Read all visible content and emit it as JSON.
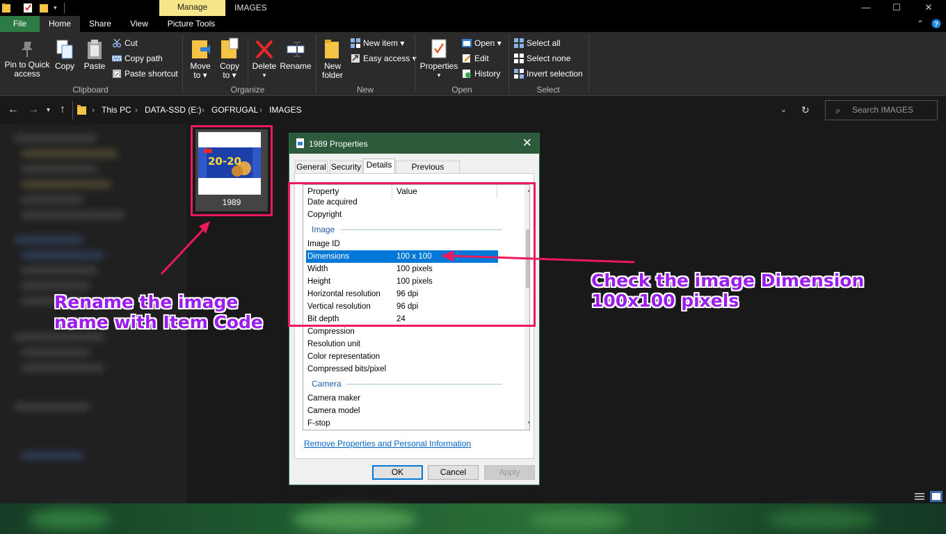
{
  "window": {
    "title": "IMAGES",
    "context_tab": "Manage",
    "controls": {
      "minimize": "—",
      "maximize": "☐",
      "close": "✕"
    }
  },
  "ribbon_tabs": [
    "File",
    "Home",
    "Share",
    "View",
    "Picture Tools"
  ],
  "ribbon": {
    "clipboard": {
      "group_label": "Clipboard",
      "pin_label": "Pin to Quick access",
      "pin_line1": "Pin to Quick",
      "pin_line2": "access",
      "copy_label": "Copy",
      "paste_label": "Paste",
      "cut_label": "Cut",
      "copy_path_label": "Copy path",
      "paste_shortcut_label": "Paste shortcut"
    },
    "organize": {
      "group_label": "Organize",
      "move_to_line1": "Move",
      "move_to_line2": "to ▾",
      "copy_to_line1": "Copy",
      "copy_to_line2": "to ▾",
      "delete_label": "Delete",
      "rename_label": "Rename"
    },
    "new": {
      "group_label": "New",
      "new_folder_line1": "New",
      "new_folder_line2": "folder",
      "new_item_label": "New item ▾",
      "easy_access_label": "Easy access ▾"
    },
    "open": {
      "group_label": "Open",
      "properties_label": "Properties",
      "open_label": "Open ▾",
      "edit_label": "Edit",
      "history_label": "History"
    },
    "select": {
      "group_label": "Select",
      "select_all_label": "Select all",
      "select_none_label": "Select none",
      "invert_selection_label": "Invert selection"
    }
  },
  "address": {
    "breadcrumbs": [
      "This PC",
      "DATA-SSD (E:)",
      "GOFRUGAL",
      "IMAGES"
    ],
    "search_placeholder": "Search IMAGES"
  },
  "file": {
    "name": "1989",
    "thumbnail_text": "20-20"
  },
  "dialog": {
    "title": "1989 Properties",
    "tabs": [
      "General",
      "Security",
      "Details",
      "Previous Versions"
    ],
    "active_tab": "Details",
    "columns": {
      "property": "Property",
      "value": "Value"
    },
    "rows_top": [
      {
        "key": "Date acquired",
        "value": ""
      },
      {
        "key": "Copyright",
        "value": ""
      }
    ],
    "section_image": "Image",
    "rows_image": [
      {
        "key": "Image ID",
        "value": ""
      },
      {
        "key": "Dimensions",
        "value": "100 x 100"
      },
      {
        "key": "Width",
        "value": "100 pixels"
      },
      {
        "key": "Height",
        "value": "100 pixels"
      },
      {
        "key": "Horizontal resolution",
        "value": "96 dpi"
      },
      {
        "key": "Vertical resolution",
        "value": "96 dpi"
      },
      {
        "key": "Bit depth",
        "value": "24"
      },
      {
        "key": "Compression",
        "value": ""
      },
      {
        "key": "Resolution unit",
        "value": ""
      },
      {
        "key": "Color representation",
        "value": ""
      },
      {
        "key": "Compressed bits/pixel",
        "value": ""
      }
    ],
    "section_camera": "Camera",
    "rows_camera": [
      {
        "key": "Camera maker",
        "value": ""
      },
      {
        "key": "Camera model",
        "value": ""
      },
      {
        "key": "F-stop",
        "value": ""
      }
    ],
    "remove_link": "Remove Properties and Personal Information",
    "buttons": {
      "ok": "OK",
      "cancel": "Cancel",
      "apply": "Apply"
    }
  },
  "annotations": {
    "rename": [
      "Rename the image",
      "name with Item Code"
    ],
    "dimension": [
      "Check the image Dimension",
      "100x100 pixels"
    ]
  },
  "colors": {
    "annotation_text": "#9b1cf0",
    "highlight_box": "#ec1a5a",
    "selection": "#0078d7",
    "file_tab": "#2c7a44",
    "context_tab": "#f6e68a"
  }
}
